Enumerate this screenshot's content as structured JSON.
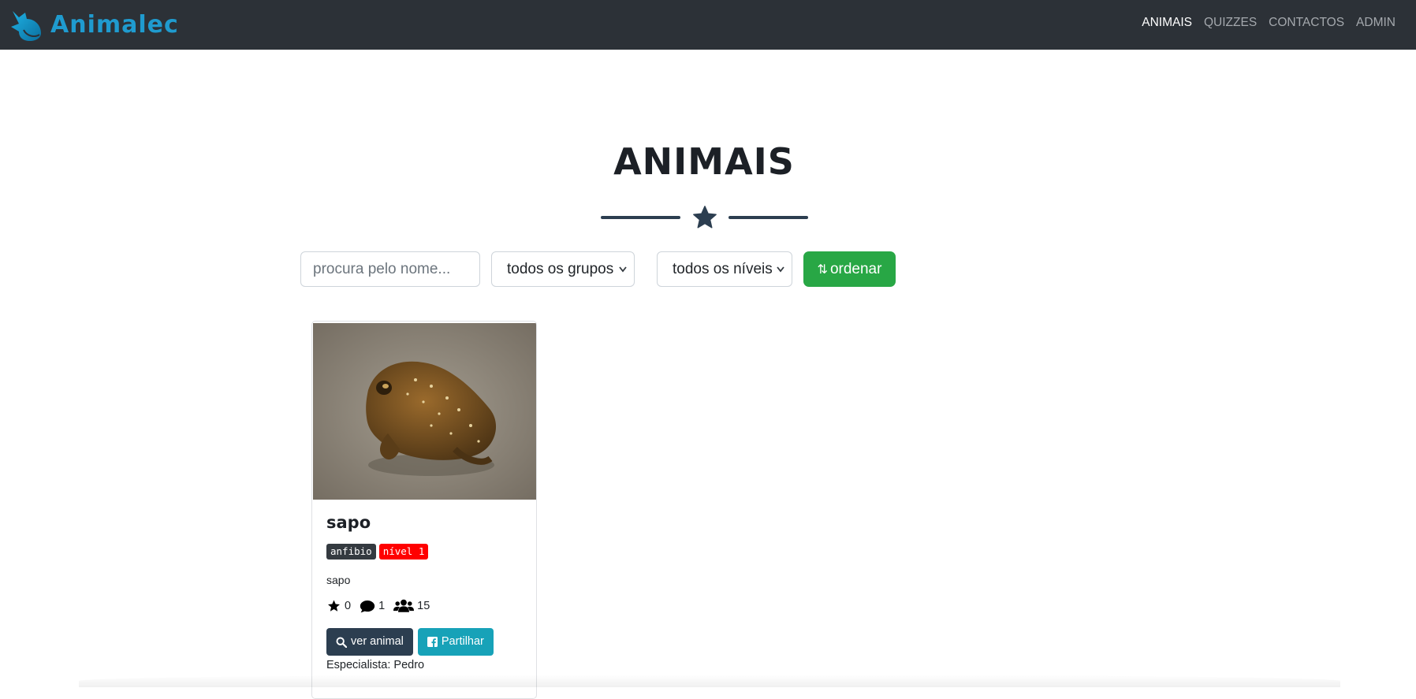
{
  "brand": {
    "name": "Animalec",
    "logo_icon": "fox-logo-icon"
  },
  "nav": {
    "items": [
      {
        "label": "ANIMAIS",
        "active": true
      },
      {
        "label": "QUIZZES",
        "active": false
      },
      {
        "label": "CONTACTOS",
        "active": false
      },
      {
        "label": "ADMIN",
        "active": false
      }
    ]
  },
  "page": {
    "title": "ANIMAIS",
    "divider_icon": "star-icon"
  },
  "filters": {
    "search_placeholder": "procura pelo nome...",
    "search_value": "",
    "group_select": "todos os grupos",
    "level_select": "todos os níveis",
    "sort_label": "ordenar",
    "sort_icon": "sort-numeric-icon"
  },
  "animals": [
    {
      "name": "sapo",
      "group": "anfibio",
      "level": "nível 1",
      "description": "sapo",
      "stars": "0",
      "comments": "1",
      "people": "15",
      "view_label": "ver animal",
      "share_label": "Partilhar",
      "specialist": "Especialista: Pedro"
    }
  ],
  "colors": {
    "navbar": "#2c3137",
    "brand": "#1f9bcf",
    "primary_dark": "#2c3e50",
    "success": "#28a745",
    "info": "#17a2b8",
    "danger": "#ff0000"
  }
}
